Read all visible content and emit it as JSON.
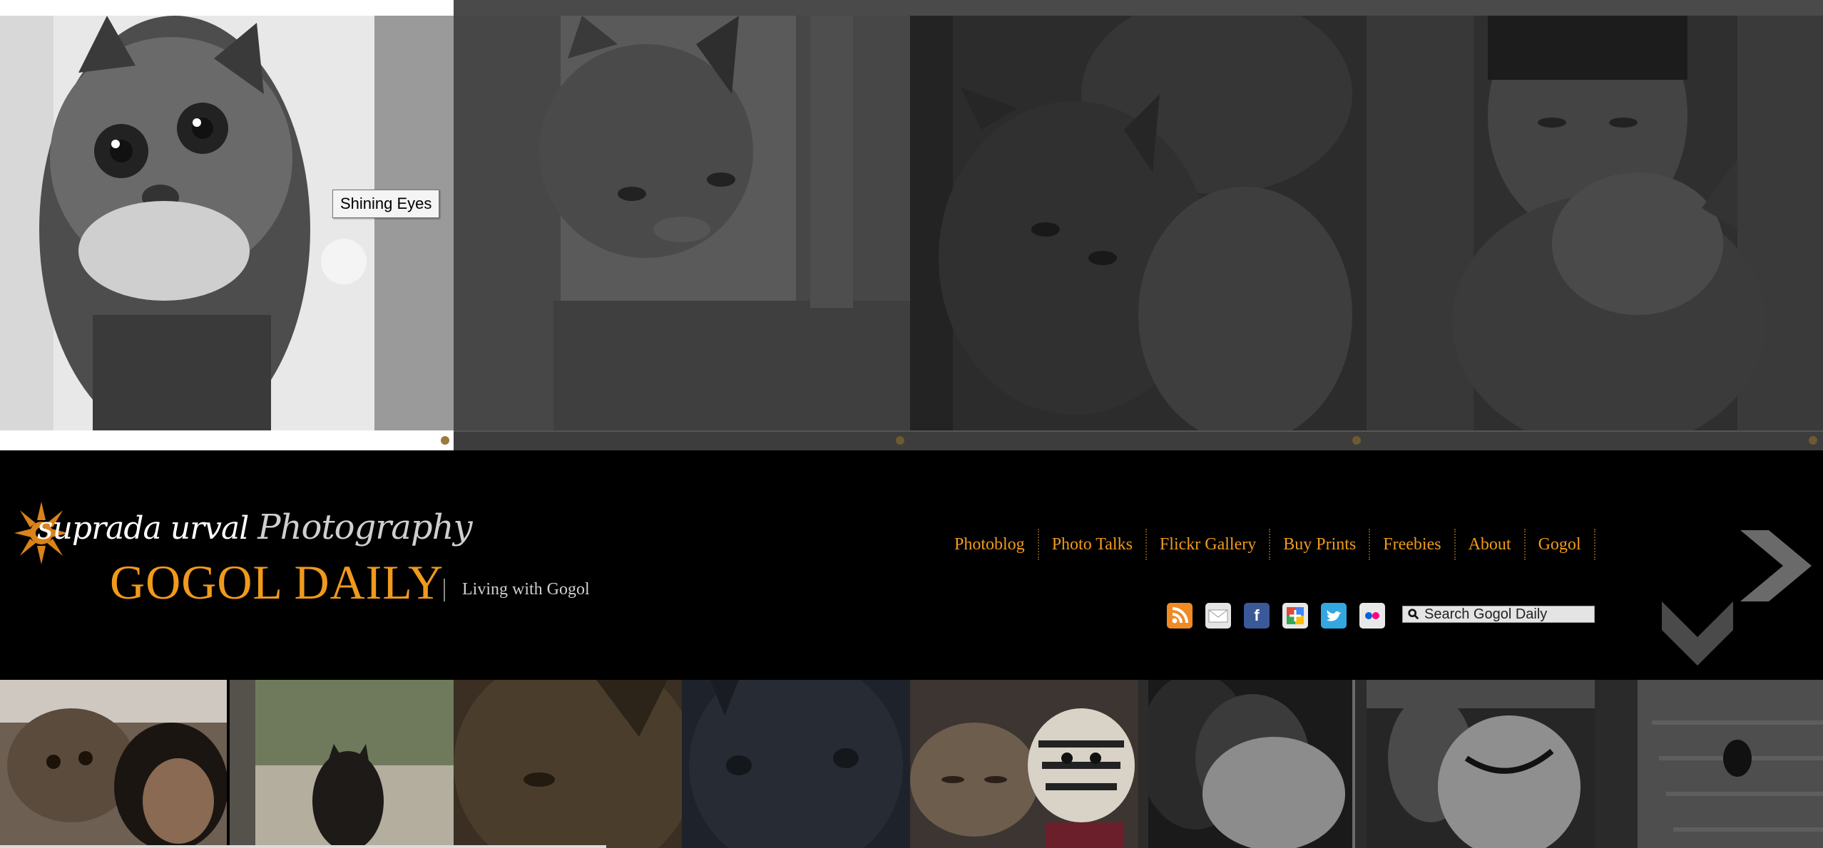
{
  "top_strip": {
    "photos": [
      {
        "name": "cat-peeking-door"
      },
      {
        "name": "cat-in-box"
      },
      {
        "name": "man-hugging-cat"
      },
      {
        "name": "man-with-cat-shoulder"
      }
    ],
    "tooltip": "Shining Eyes"
  },
  "header": {
    "logo_name": "suprada urval",
    "logo_photography": "Photography",
    "site_title": "GOGOL DAILY",
    "tagline": "Living with Gogol",
    "nav": [
      "Photoblog",
      "Photo Talks",
      "Flickr Gallery",
      "Buy Prints",
      "Freebies",
      "About",
      "Gogol"
    ],
    "social_icons": [
      "rss-icon",
      "email-icon",
      "facebook-icon",
      "google-plus-icon",
      "twitter-icon",
      "flickr-icon"
    ],
    "search_placeholder": "Search Gogol Daily"
  },
  "colors": {
    "accent": "#f09a1c",
    "background": "#000000"
  },
  "bottom_grid": {
    "thumbs": [
      {
        "name": "cat-with-girl"
      },
      {
        "name": "cat-at-window"
      },
      {
        "name": "cat-closeup-sepia"
      },
      {
        "name": "cat-closeup-blue"
      },
      {
        "name": "cat-with-tiger-toy"
      },
      {
        "name": "man-holding-kitten"
      },
      {
        "name": "two-cats-sitting"
      },
      {
        "name": "cat-on-stairs"
      }
    ]
  }
}
